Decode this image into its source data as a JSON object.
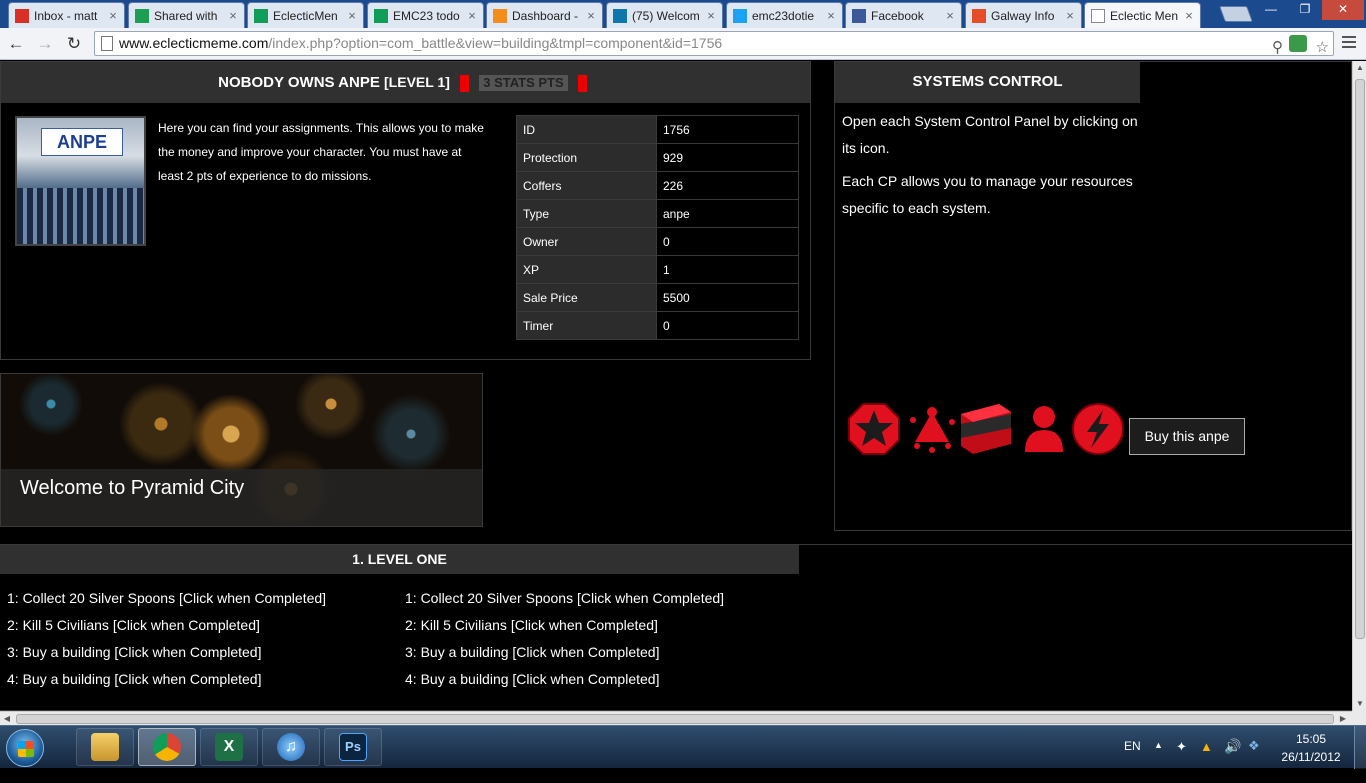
{
  "browser": {
    "tabs": [
      {
        "label": "Inbox - matt",
        "icon": "gmail-icon",
        "color": "#d93025"
      },
      {
        "label": "Shared with",
        "icon": "drive-icon",
        "color": "#1e9e52"
      },
      {
        "label": "EclecticMen",
        "icon": "sheets-icon",
        "color": "#0f9d58"
      },
      {
        "label": "EMC23 todo",
        "icon": "sheets-icon",
        "color": "#0f9d58"
      },
      {
        "label": "Dashboard -",
        "icon": "dashboard-icon",
        "color": "#f28c1a"
      },
      {
        "label": "(75) Welcom",
        "icon": "linkedin-icon",
        "color": "#0e76a8"
      },
      {
        "label": "emc23dotie",
        "icon": "twitter-icon",
        "color": "#1da1f2"
      },
      {
        "label": "Facebook",
        "icon": "facebook-icon",
        "color": "#3b5998"
      },
      {
        "label": "Galway Info",
        "icon": "joomla-icon",
        "color": "#e44d26"
      },
      {
        "label": "Eclectic Men",
        "icon": "page-icon",
        "color": "#ffffff",
        "active": true
      }
    ],
    "url_host": "www.eclecticmeme.com",
    "url_path": "/index.php?option=com_battle&view=building&tmpl=component&id=1756"
  },
  "building": {
    "title_prefix": "NOBODY OWNS ANPE",
    "level_tag": "[LEVEL 1]",
    "stats_badge": "3 STATS PTS",
    "sign_text": "ANPE",
    "intro": "Here you can find your assignments. This allows you to make the money and improve your character. You must have at least 2 pts of experience to do missions.",
    "info": [
      {
        "key": "ID",
        "value": "1756"
      },
      {
        "key": "Protection",
        "value": "929"
      },
      {
        "key": "Coffers",
        "value": "226"
      },
      {
        "key": "Type",
        "value": "anpe"
      },
      {
        "key": "Owner",
        "value": "0"
      },
      {
        "key": "XP",
        "value": "1"
      },
      {
        "key": "Sale Price",
        "value": "5500"
      },
      {
        "key": "Timer",
        "value": "0"
      }
    ]
  },
  "systems": {
    "title": "SYSTEMS CONTROL",
    "line1": "Open each System Control Panel by clicking on its icon.",
    "line2": "Each CP allows you to manage your resources specific to each system.",
    "buy_label": "Buy this anpe",
    "icons": [
      "star-octagon-icon",
      "molecule-triangle-icon",
      "box-icon",
      "person-icon",
      "lightning-icon"
    ],
    "accent": "#e0101f"
  },
  "banner": {
    "caption": "Welcome to Pyramid City"
  },
  "level": {
    "title": "1. LEVEL ONE",
    "tasks_left": [
      "1: Collect 20 Silver Spoons [Click when Completed]",
      "2: Kill 5 Civilians [Click when Completed]",
      "3: Buy a building [Click when Completed]",
      "4: Buy a building [Click when Completed]"
    ],
    "tasks_right": [
      "1: Collect 20 Silver Spoons [Click when Completed]",
      "2: Kill 5 Civilians [Click when Completed]",
      "3: Buy a building [Click when Completed]",
      "4: Buy a building [Click when Completed]"
    ]
  },
  "taskbar": {
    "apps": [
      "explorer-icon",
      "chrome-icon",
      "excel-icon",
      "itunes-icon",
      "photoshop-icon"
    ],
    "photoshop_label": "Ps",
    "lang": "EN",
    "time": "15:05",
    "date": "26/11/2012"
  }
}
